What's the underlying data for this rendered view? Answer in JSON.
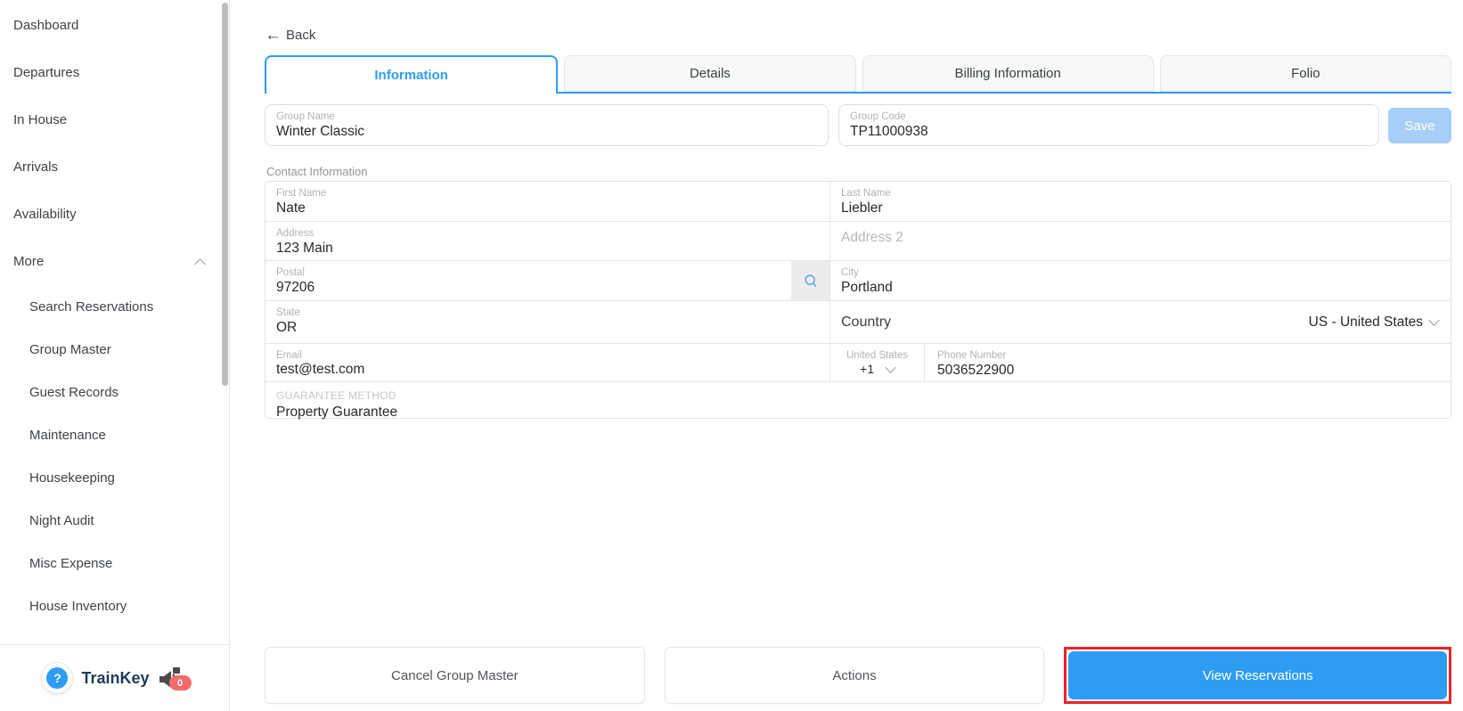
{
  "sidebar": {
    "items": [
      "Dashboard",
      "Departures",
      "In House",
      "Arrivals",
      "Availability"
    ],
    "more_label": "More",
    "sub_items": [
      "Search Reservations",
      "Group Master",
      "Guest Records",
      "Maintenance",
      "Housekeeping",
      "Night Audit",
      "Misc Expense",
      "House Inventory"
    ],
    "footer": {
      "brand": "TrainKey",
      "help_glyph": "?",
      "badge_count": "0"
    }
  },
  "header": {
    "back_label": "Back",
    "back_arrow": "←"
  },
  "tabs": {
    "items": [
      {
        "label": "Information",
        "active": true
      },
      {
        "label": "Details",
        "active": false
      },
      {
        "label": "Billing Information",
        "active": false
      },
      {
        "label": "Folio",
        "active": false
      }
    ]
  },
  "group": {
    "name": {
      "label": "Group Name",
      "value": "Winter Classic"
    },
    "code": {
      "label": "Group Code",
      "value": "TP11000938"
    },
    "save_label": "Save"
  },
  "contact": {
    "section_label": "Contact Information",
    "first_name": {
      "label": "First Name",
      "value": "Nate"
    },
    "last_name": {
      "label": "Last Name",
      "value": "Liebler"
    },
    "address": {
      "label": "Address",
      "value": "123 Main"
    },
    "address2": {
      "placeholder": "Address 2"
    },
    "postal": {
      "label": "Postal",
      "value": "97206"
    },
    "city": {
      "label": "City",
      "value": "Portland"
    },
    "state": {
      "label": "State",
      "value": "OR"
    },
    "country": {
      "label": "Country",
      "value": "US - United States"
    },
    "dial": {
      "label": "United States",
      "value": "+1"
    },
    "phone": {
      "label": "Phone Number",
      "value": "5036522900"
    },
    "guarantee": {
      "label": "GUARANTEE METHOD",
      "value": "Property Guarantee"
    }
  },
  "footer_actions": {
    "cancel_label": "Cancel Group Master",
    "actions_label": "Actions",
    "view_reservations_label": "View Reservations"
  },
  "colors": {
    "accent_blue": "#2E9CF4",
    "save_disabled_blue": "#A6CEF6",
    "highlight_red": "#EB2227",
    "badge_red": "#F56B6B",
    "brand_navy": "#1C3C5E"
  }
}
